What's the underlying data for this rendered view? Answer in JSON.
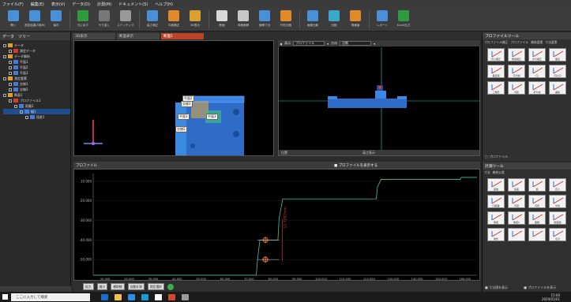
{
  "menubar": [
    "ファイル(F)",
    "編集(E)",
    "表示(V)",
    "データ(D)",
    "計測(M)",
    "ドキュメント(S)",
    "ヘルプ(H)"
  ],
  "ribbon": [
    {
      "label": "開く",
      "color": "#4a90d9"
    },
    {
      "label": "測定結果の読み込み",
      "color": "#4a90d9"
    },
    {
      "label": "保存",
      "color": "#4a90d9"
    },
    {
      "label": "元に戻す",
      "color": "#2e9c3e"
    },
    {
      "label": "やり直し",
      "color": "#777777"
    },
    {
      "label": "ステッチング",
      "color": "#999999"
    },
    {
      "label": "高さ補正",
      "color": "#4a90d9"
    },
    {
      "label": "平面補正",
      "color": "#e08a2a"
    },
    {
      "label": "3D表示",
      "color": "#d9a030"
    },
    {
      "label": "断面",
      "color": "#d9d9d9"
    },
    {
      "label": "体積面積",
      "color": "#c8c8c8"
    },
    {
      "label": "面積寸法",
      "color": "#4a90d9"
    },
    {
      "label": "外形比較",
      "color": "#e08a2a"
    },
    {
      "label": "画像比較",
      "color": "#4a90d9"
    },
    {
      "label": "比較",
      "color": "#3aa8c8"
    },
    {
      "label": "規格値",
      "color": "#e08a2a"
    },
    {
      "label": "レポート",
      "color": "#4a90d9"
    },
    {
      "label": "Excel出力",
      "color": "#2e9c3e"
    }
  ],
  "tree": {
    "tabs": [
      "データ",
      "ツリー"
    ],
    "items": [
      {
        "label": "データ",
        "depth": 0,
        "icon": "folder"
      },
      {
        "label": "測定データ",
        "depth": 1,
        "icon": "red"
      },
      {
        "label": "データ解析",
        "depth": 0,
        "icon": "folder"
      },
      {
        "label": "平面1",
        "depth": 1,
        "icon": "blue"
      },
      {
        "label": "平面2",
        "depth": 1,
        "icon": "blue"
      },
      {
        "label": "平面3",
        "depth": 1,
        "icon": "blue"
      },
      {
        "label": "測定要素",
        "depth": 0,
        "icon": "folder"
      },
      {
        "label": "交線1",
        "depth": 1,
        "icon": "blue"
      },
      {
        "label": "交線2",
        "depth": 1,
        "icon": "blue"
      },
      {
        "label": "断面1",
        "depth": 0,
        "icon": "folder"
      },
      {
        "label": "プロファイル1",
        "depth": 1,
        "icon": "red"
      },
      {
        "label": "距離1",
        "depth": 2,
        "icon": "blue"
      },
      {
        "label": "幅1",
        "depth": 3,
        "icon": "blue",
        "selected": true
      },
      {
        "label": "段差1",
        "depth": 4,
        "icon": "blue"
      }
    ]
  },
  "tabs": [
    {
      "label": "3D表示",
      "active": false
    },
    {
      "label": "断面表示",
      "active": false
    },
    {
      "label": "断面1",
      "active": true
    }
  ],
  "view3d": {
    "labels": [
      "平面2",
      "交線1",
      "平面1",
      "平面3",
      "交線2"
    ]
  },
  "view2d": {
    "dd1_label": "表示",
    "dd1": "プロファイル",
    "dd2_label": "方向",
    "dd2": "自動",
    "status_left": "位置",
    "status_right": "高さ表示"
  },
  "profile": {
    "title": "プロファイル",
    "checkbox": "プロファイルを表示する",
    "measure_label": "11.7287mm",
    "toolstrip": [
      "拡大",
      "縮小",
      "補助線",
      "自動計測",
      "測定選択"
    ]
  },
  "chart_data": {
    "type": "line",
    "xlabel": "",
    "ylabel": "",
    "x_ticks": [
      "10.000",
      "20.000",
      "30.000",
      "40.000",
      "50.000",
      "60.000",
      "70.000",
      "80.000",
      "90.000",
      "100.000",
      "110.000",
      "120.000",
      "130.000",
      "140.000",
      "150.000",
      "160.000"
    ],
    "y_ticks": [
      "-10.000",
      "-20.000",
      "-30.000",
      "-40.000",
      "-50.000"
    ],
    "xlim": [
      5,
      165
    ],
    "ylim": [
      -58,
      -6
    ],
    "series": [
      {
        "color": "#47c0a0",
        "x": [
          5,
          60,
          61,
          73,
          73.5,
          74.5,
          82,
          82.5,
          84,
          123,
          123.5,
          125,
          158,
          158.5,
          165
        ],
        "y": [
          -58,
          -58,
          -58,
          -58,
          -50,
          -40,
          -40,
          -29,
          -19,
          -19,
          -13,
          -9,
          -9,
          -8,
          -8
        ]
      }
    ]
  },
  "rpanel1": {
    "title": "プロファイルツール",
    "tabs": [
      "プロファイル補正",
      "プロファイル",
      "補助要素",
      "寸法要素"
    ],
    "tools": [
      "高さ補正",
      "角度補正",
      "水平補正",
      "垂直",
      "垂直線",
      "平行線",
      "円",
      "同心円",
      "三角形",
      "円弧",
      "折れ線",
      "垂線"
    ],
    "footer": "プロファイル"
  },
  "rpanel2": {
    "title": "計測ツール",
    "tabs": [
      "寸法",
      "幾何公差"
    ],
    "tools": [
      "距離",
      "段差",
      "幅",
      "高さ",
      "円距離",
      "円径",
      "円周",
      "半径",
      "角度",
      "角度2",
      "面積",
      "断面積",
      "除外",
      "",
      "",
      "表示"
    ],
    "footer1": "寸法値を表示",
    "footer2": "プロファイルを表示"
  },
  "taskbar": {
    "search_placeholder": "ここに入力して検索",
    "time": "15:00",
    "date": "2020/01/01",
    "icons": [
      "#1a6fcb",
      "#f2c14a",
      "#2c8ee8",
      "#1a9ad8",
      "#ffffff",
      "#d14b2a",
      "#999999"
    ]
  }
}
